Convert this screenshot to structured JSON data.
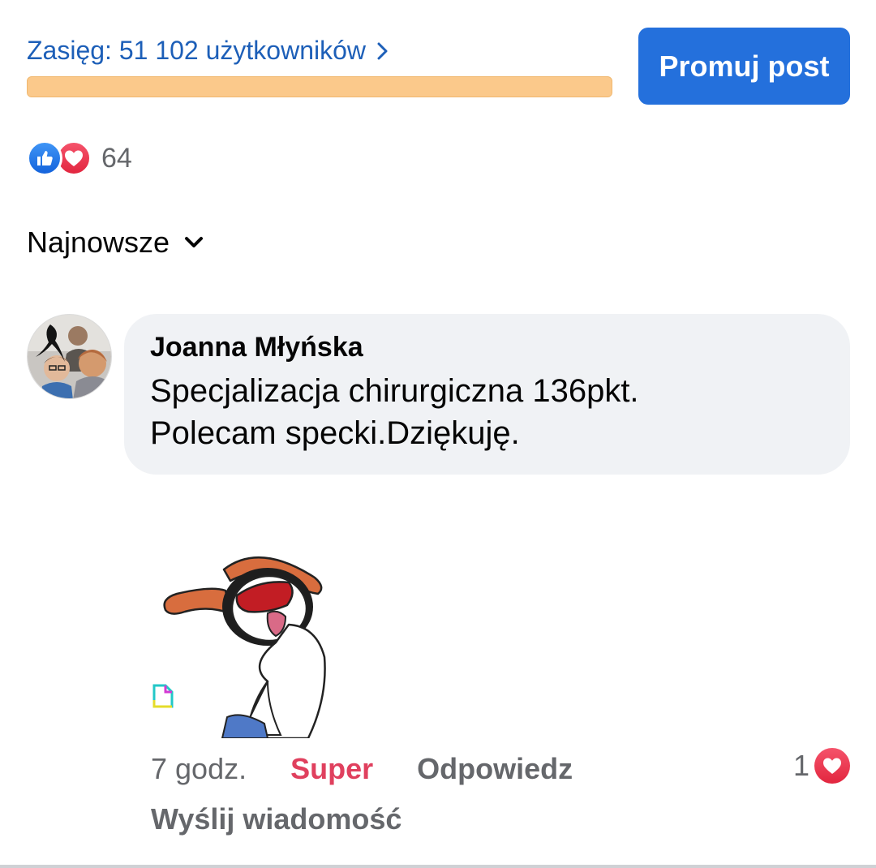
{
  "reach": {
    "label": "Zasięg: 51 102 użytkowników",
    "bar_color": "#fbc98b"
  },
  "promote": {
    "label": "Promuj post",
    "color": "#2470dc"
  },
  "reactions": {
    "icons": [
      "like-icon",
      "love-icon"
    ],
    "count": "64"
  },
  "sort": {
    "label": "Najnowsze"
  },
  "comment": {
    "author": "Joanna Młyńska",
    "text": "Specjalizacja chirurgiczna 136pkt.\nPolecam specki.Dziękuję.",
    "sticker": "cheering-character-sticker",
    "actions": {
      "time": "7 godz.",
      "super": "Super",
      "reply": "Odpowiedz",
      "send_message": "Wyślij wiadomość"
    },
    "reaction": {
      "count": "1",
      "icon": "love-icon"
    }
  },
  "colors": {
    "link": "#1d5fb8",
    "super_active": "#e0405e",
    "secondary_text": "#65676b",
    "bubble": "#f0f2f5"
  }
}
